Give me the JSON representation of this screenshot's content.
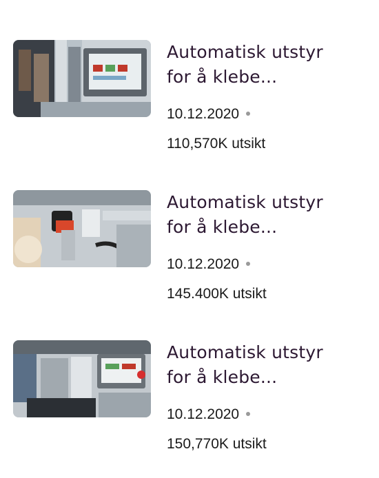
{
  "videos": [
    {
      "thumbnail_icon": "labeling-machine-thumbnail",
      "title_line1": "Automatisk utstyr",
      "title_line2": "for å klebe...",
      "date": "10.12.2020",
      "views": "110,570K utsikt"
    },
    {
      "thumbnail_icon": "labeling-machine-thumbnail",
      "title_line1": "Automatisk utstyr",
      "title_line2": "for å klebe...",
      "date": "10.12.2020",
      "views": "145.400K utsikt"
    },
    {
      "thumbnail_icon": "labeling-machine-thumbnail",
      "title_line1": "Automatisk utstyr",
      "title_line2": "for å klebe...",
      "date": "10.12.2020",
      "views": "150,770K utsikt"
    }
  ],
  "colors": {
    "title": "#2c1832",
    "meta": "#1a1a1a",
    "dot": "#9a9a9a",
    "background": "#ffffff"
  }
}
